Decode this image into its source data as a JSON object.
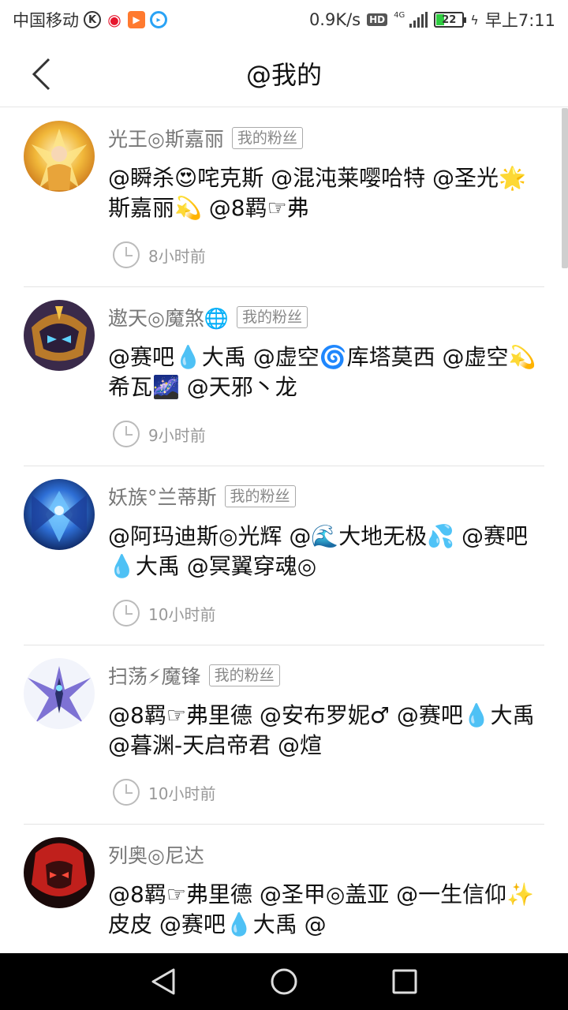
{
  "status_bar": {
    "carrier": "中国移动",
    "net_speed": "0.9K/s",
    "hd": "HD",
    "network": "4G",
    "battery": "22",
    "time": "早上7:11",
    "icons": [
      "k-icon",
      "weibo-icon",
      "video-icon",
      "browser-icon"
    ]
  },
  "header": {
    "title": "@我的"
  },
  "feed": [
    {
      "username": "光王◎斯嘉丽",
      "badge": "我的粉丝",
      "content": " @瞬杀😍咤克斯 @混沌莱嘤哈特 @圣光🌟斯嘉丽💫 @8羁☞弗",
      "time": "8小时前"
    },
    {
      "username": "遨天◎魔煞🌐",
      "badge": "我的粉丝",
      "content": " @赛吧💧大禹 @虚空🌀库塔莫西 @虚空💫希瓦🌌 @天邪丶龙",
      "time": "9小时前"
    },
    {
      "username": "妖族°兰蒂斯",
      "badge": "我的粉丝",
      "content": " @阿玛迪斯◎光辉 @🌊大地无极💦 @赛吧💧大禹 @冥翼穿魂◎",
      "time": "10小时前"
    },
    {
      "username": "扫荡⚡魔锋",
      "badge": "我的粉丝",
      "content": " @8羁☞弗里德 @安布罗妮♂ @赛吧💧大禹 @暮渊-天启帝君 @煊",
      "time": "10小时前"
    },
    {
      "username": "列奥◎尼达",
      "badge": "",
      "content": " @8羁☞弗里德 @圣甲◎盖亚 @一生信仰✨皮皮 @赛吧💧大禹 @",
      "time": ""
    }
  ]
}
